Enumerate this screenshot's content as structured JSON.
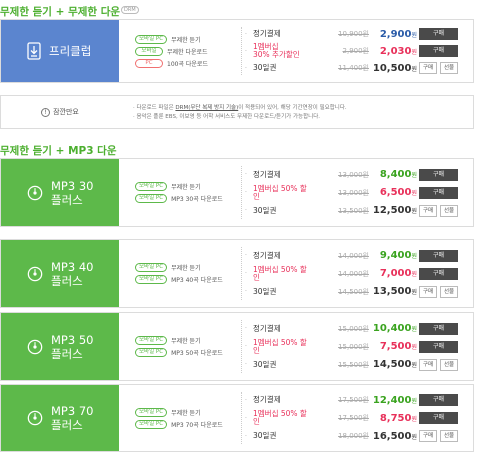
{
  "section1": {
    "title": "무제한 듣기 + 무제한 다운",
    "badge": "DRM"
  },
  "section2": {
    "title": "무제한 듣기 + MP3 다운"
  },
  "colors": {
    "blue": "#5b85cf",
    "green": "#5db94a",
    "accent_red": "#e8305a",
    "price_blue": "#2a5ba8",
    "price_green": "#3aa31f"
  },
  "cards": [
    {
      "name": "프리클럽",
      "icon": "download-icon",
      "color": "blue",
      "features": [
        {
          "tag": "모바일 PC",
          "tag_color": "green",
          "text": "무제한 듣기"
        },
        {
          "tag": "모바일",
          "tag_color": "green",
          "text": "무제한 다운로드"
        },
        {
          "tag": "PC",
          "tag_color": "red",
          "text": "100곡 다운로드"
        }
      ],
      "plans": [
        {
          "label": "정기결제",
          "original": "10,900원",
          "price": "2,900",
          "unit": "원",
          "price_color": "blue",
          "buttons": [
            "구매"
          ]
        },
        {
          "label": "1멤버십\n30% 추가할인",
          "original": "2,900원",
          "price": "2,030",
          "unit": "원",
          "price_color": "red",
          "red_label": true,
          "buttons": [
            "구매"
          ]
        },
        {
          "label": "30일권",
          "original": "11,400원",
          "price": "10,500",
          "unit": "원",
          "price_color": "dark",
          "buttons": [
            "구매",
            "선물"
          ]
        }
      ]
    },
    {
      "name": "MP3 30\n플러스",
      "icon": "music-disc-icon",
      "color": "green",
      "features": [
        {
          "tag": "모바일 PC",
          "tag_color": "green",
          "text": "무제한 듣기"
        },
        {
          "tag": "모바일 PC",
          "tag_color": "green",
          "text": "MP3 30곡 다운로드"
        }
      ],
      "plans": [
        {
          "label": "정기결제",
          "original": "13,000원",
          "price": "8,400",
          "unit": "원",
          "price_color": "green",
          "buttons": [
            "구매"
          ]
        },
        {
          "label": "1멤버십 50% 할인",
          "original": "13,000원",
          "price": "6,500",
          "unit": "원",
          "price_color": "red",
          "red_label": true,
          "buttons": [
            "구매"
          ]
        },
        {
          "label": "30일권",
          "original": "13,500원",
          "price": "12,500",
          "unit": "원",
          "price_color": "dark",
          "buttons": [
            "구매",
            "선물"
          ]
        }
      ]
    },
    {
      "name": "MP3 40\n플러스",
      "icon": "music-disc-icon",
      "color": "green",
      "features": [
        {
          "tag": "모바일 PC",
          "tag_color": "green",
          "text": "무제한 듣기"
        },
        {
          "tag": "모바일 PC",
          "tag_color": "green",
          "text": "MP3 40곡 다운로드"
        }
      ],
      "plans": [
        {
          "label": "정기결제",
          "original": "14,000원",
          "price": "9,400",
          "unit": "원",
          "price_color": "green",
          "buttons": [
            "구매"
          ]
        },
        {
          "label": "1멤버십 50% 할인",
          "original": "14,000원",
          "price": "7,000",
          "unit": "원",
          "price_color": "red",
          "red_label": true,
          "buttons": [
            "구매"
          ]
        },
        {
          "label": "30일권",
          "original": "14,500원",
          "price": "13,500",
          "unit": "원",
          "price_color": "dark",
          "buttons": [
            "구매",
            "선물"
          ]
        }
      ]
    },
    {
      "name": "MP3 50\n플러스",
      "icon": "music-disc-icon",
      "color": "green",
      "features": [
        {
          "tag": "모바일 PC",
          "tag_color": "green",
          "text": "무제한 듣기"
        },
        {
          "tag": "모바일 PC",
          "tag_color": "green",
          "text": "MP3 50곡 다운로드"
        }
      ],
      "plans": [
        {
          "label": "정기결제",
          "original": "15,000원",
          "price": "10,400",
          "unit": "원",
          "price_color": "green",
          "buttons": [
            "구매"
          ]
        },
        {
          "label": "1멤버십 50% 할인",
          "original": "15,000원",
          "price": "7,500",
          "unit": "원",
          "price_color": "red",
          "red_label": true,
          "buttons": [
            "구매"
          ]
        },
        {
          "label": "30일권",
          "original": "15,500원",
          "price": "14,500",
          "unit": "원",
          "price_color": "dark",
          "buttons": [
            "구매",
            "선물"
          ]
        }
      ]
    },
    {
      "name": "MP3 70\n플러스",
      "icon": "music-disc-icon",
      "color": "green",
      "features": [
        {
          "tag": "모바일 PC",
          "tag_color": "green",
          "text": "무제한 듣기"
        },
        {
          "tag": "모바일 PC",
          "tag_color": "green",
          "text": "MP3 70곡 다운로드"
        }
      ],
      "plans": [
        {
          "label": "정기결제",
          "original": "17,500원",
          "price": "12,400",
          "unit": "원",
          "price_color": "green",
          "buttons": [
            "구매"
          ]
        },
        {
          "label": "1멤버십 50% 할인",
          "original": "17,500원",
          "price": "8,750",
          "unit": "원",
          "price_color": "red",
          "red_label": true,
          "buttons": [
            "구매"
          ]
        },
        {
          "label": "30일권",
          "original": "18,000원",
          "price": "16,500",
          "unit": "원",
          "price_color": "dark",
          "buttons": [
            "구매",
            "선물"
          ]
        }
      ]
    }
  ],
  "notice": {
    "label": "잠깐만요",
    "line1_pre": "다운로드 파일은 ",
    "line1_link": "DRM(무단 복제 방지 기술)",
    "line1_post": "이 적용되어 있어, 해당 기간연장이 필요합니다.",
    "line2": "음악은 플룬 EBS, 이보영 등 어학 서비스도 무제한 다운로드/듣기가 가능합니다."
  }
}
